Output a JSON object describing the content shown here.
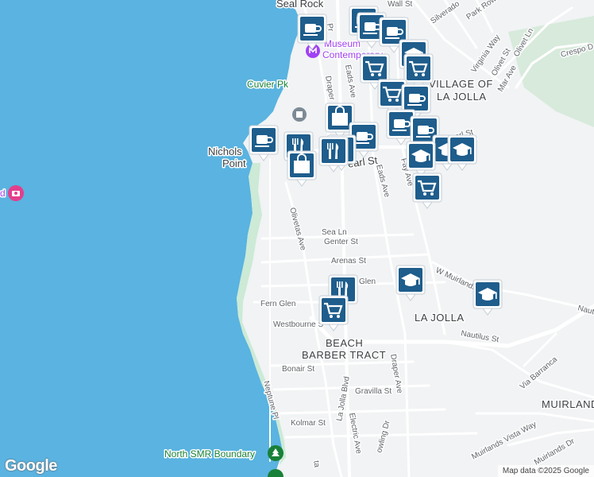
{
  "map": {
    "colors": {
      "water": "#5ab3e0",
      "land": "#f1f3f4",
      "park": "#ccead6",
      "road": "#ffffff",
      "pin": "#1e5d8c"
    },
    "labels": {
      "seal_rock": "Seal Rock",
      "museum_line1": "Museum",
      "museum_line2": "Contemporary",
      "cuvier_pk": "Cuvier Pk",
      "nichols": "Nichols",
      "point": "Point",
      "village_of": "VILLAGE OF",
      "la_jolla_village": "LA JOLLA",
      "la_jolla": "LA JOLLA",
      "beach": "BEACH",
      "barber_tract": "BARBER TRACT",
      "muirlands": "MUIRLANDS",
      "north_smr": "North SMR Boundary"
    },
    "streets": {
      "wall_st": "Wall St",
      "silverado": "Silverado",
      "park_row": "Park Row",
      "virginia_way": "Virginia Way",
      "olivet_st": "Olivet St",
      "olivet_ln": "Olivet Ln",
      "crespo": "Crespo D",
      "mar_ave": "Mar Ave",
      "eads_ave_n": "Eads Ave",
      "draper": "Draper",
      "pearl_st": "Pearl St",
      "pearl_st_e": "Pearl St",
      "eads_ave": "Eads Ave",
      "fay_ave": "Fay Ave",
      "olivetas_ave": "Olivetas Ave",
      "sea_ln": "Sea Ln",
      "genter_st": "Genter St",
      "arenas_st": "Arenas St",
      "glen": "Glen",
      "fern_glen": "Fern Glen",
      "westbourne": "Westbourne S",
      "w_muirlands": "W Muirlands",
      "nautilus_st": "Nautilus St",
      "nauti": "Nauti",
      "via_barranca": "Via Barranca",
      "bonair_st": "Bonair St",
      "gravilla_st": "Gravilla St",
      "draper_ave": "Draper Ave",
      "la_jolla_blvd": "La Jolla Blvd",
      "electric_ave": "Electric Ave",
      "neptune_pl": "Neptune Pl",
      "kolmar_st": "Kolmar St",
      "muirlands_vista_way": "Muirlands Vista Way",
      "muirlands_dr": "Muirlands Dr",
      "pr": "Pr",
      "ta": "ta",
      "owling_dr": "owling Dr"
    },
    "pins": [
      {
        "icon": "coffee"
      },
      {
        "icon": "coffee"
      },
      {
        "icon": "coffee"
      },
      {
        "icon": "coffee"
      },
      {
        "icon": "school"
      },
      {
        "icon": "shopping-cart"
      },
      {
        "icon": "shopping-cart"
      },
      {
        "icon": "shopping-cart"
      },
      {
        "icon": "coffee"
      },
      {
        "icon": "shopping-bag"
      },
      {
        "icon": "restaurant"
      },
      {
        "icon": "coffee"
      },
      {
        "icon": "coffee"
      },
      {
        "icon": "school"
      },
      {
        "icon": "school"
      },
      {
        "icon": "shopping-cart"
      },
      {
        "icon": "coffee"
      },
      {
        "icon": "shopping-bag"
      },
      {
        "icon": "school"
      },
      {
        "icon": "school"
      },
      {
        "icon": "shopping-cart"
      },
      {
        "icon": "shopping-cart"
      }
    ]
  },
  "footer": {
    "google_logo": "Google",
    "attribution": "Map data ©2025 Google"
  }
}
